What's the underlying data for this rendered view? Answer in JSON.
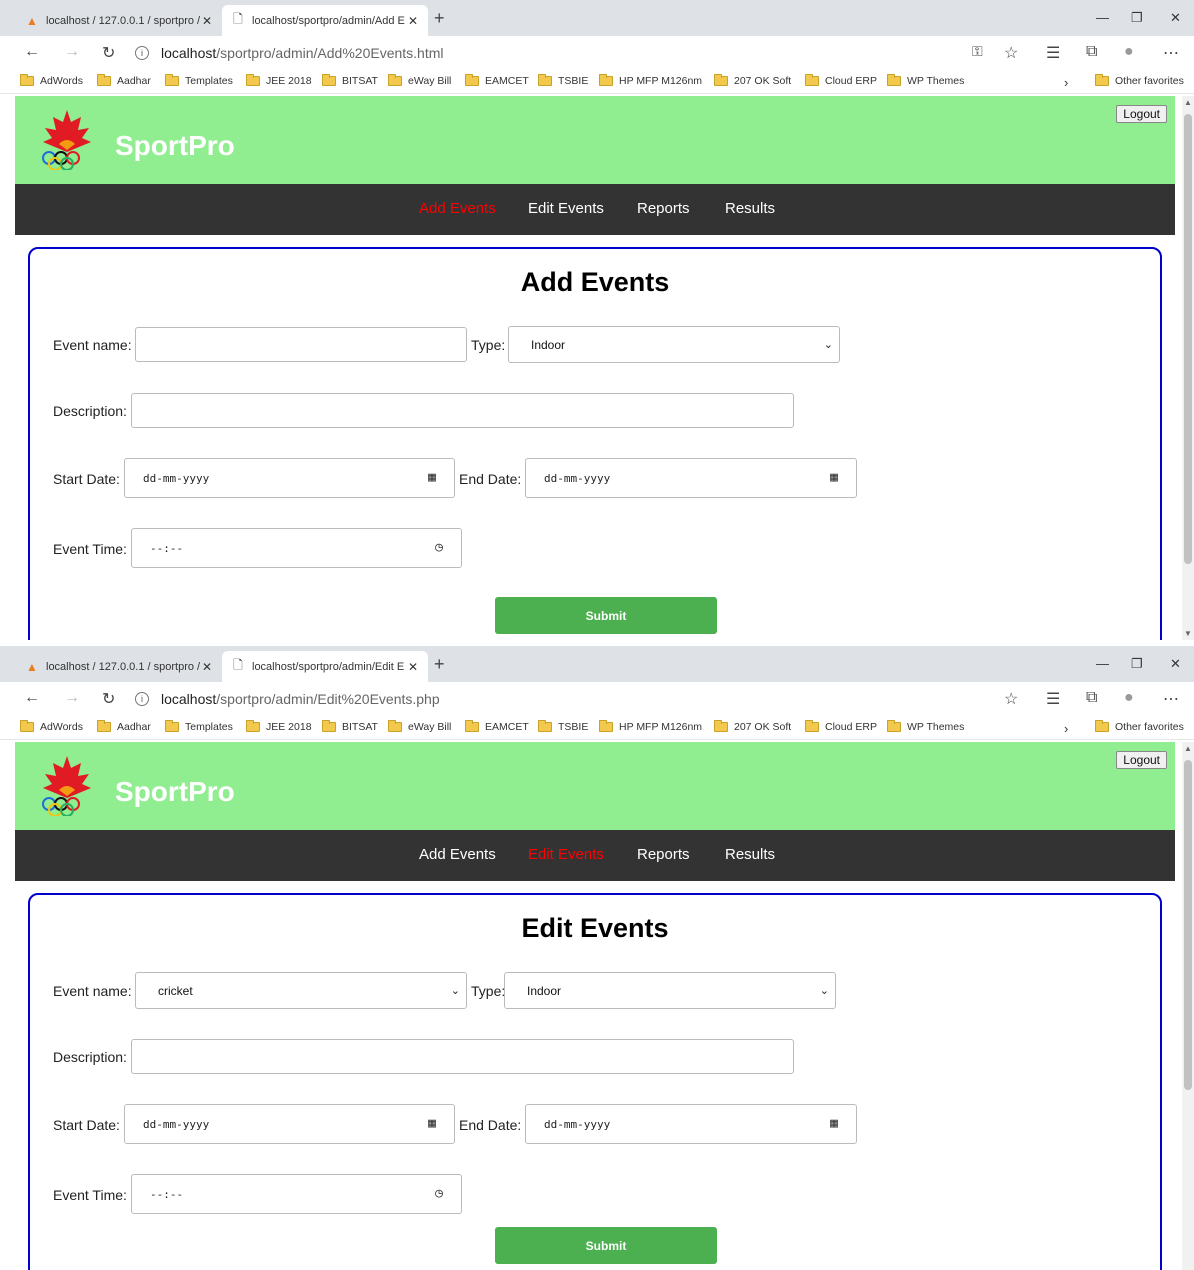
{
  "browser": {
    "inactive_tab_title": "localhost / 127.0.0.1 / sportpro /",
    "new_tab_symbol": "+",
    "bookmarks": [
      "AdWords",
      "Aadhar",
      "Templates",
      "JEE 2018",
      "BITSAT",
      "eWay Bill",
      "EAMCET",
      "TSBIE",
      "HP MFP M126nm",
      "207 OK Soft",
      "Cloud ERP",
      "WP Themes"
    ],
    "other_favorites": "Other favorites"
  },
  "site": {
    "brand": "SportPro",
    "logout_label": "Logout",
    "nav": [
      "Add Events",
      "Edit Events",
      "Reports",
      "Results"
    ]
  },
  "form": {
    "event_name_label": "Event name:",
    "type_label": "Type:",
    "type_value": "Indoor",
    "description_label": "Description:",
    "start_date_label": "Start Date:",
    "end_date_label": "End Date:",
    "date_placeholder": "dd-mm-yyyy",
    "event_time_label": "Event Time:",
    "time_placeholder": "--:--",
    "submit_label": "Submit"
  },
  "window1": {
    "tab_title": "localhost/sportpro/admin/Add E",
    "url_host": "localhost",
    "url_path": "/sportpro/admin/Add%20Events.html",
    "heading": "Add Events",
    "active_nav": "Add Events",
    "event_name_value": ""
  },
  "window2": {
    "tab_title": "localhost/sportpro/admin/Edit E",
    "url_host": "localhost",
    "url_path": "/sportpro/admin/Edit%20Events.php",
    "heading": "Edit Events",
    "active_nav": "Edit Events",
    "event_name_value": "cricket"
  },
  "colors": {
    "header_bg": "#90ee90",
    "nav_bg": "#333333",
    "active_nav": "#ff0000",
    "card_border": "#0000cc",
    "submit_bg": "#4caf50"
  },
  "icons": [
    "phpmyadmin-icon",
    "page-icon",
    "close-icon",
    "back-icon",
    "forward-icon",
    "refresh-icon",
    "info-icon",
    "key-icon",
    "star-icon",
    "favorites-icon",
    "collections-icon",
    "profile-icon",
    "more-icon",
    "folder-icon",
    "calendar-icon",
    "clock-icon",
    "chevron-down-icon",
    "minimize-icon",
    "restore-icon"
  ]
}
